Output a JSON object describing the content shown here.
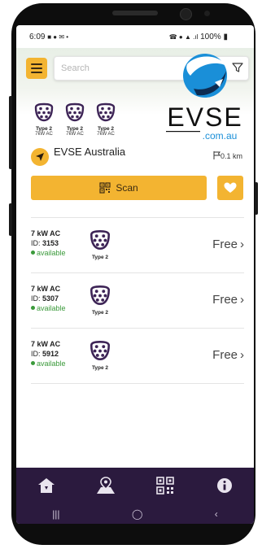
{
  "status_bar": {
    "time": "6:09",
    "battery": "100%"
  },
  "search": {
    "placeholder": "Search"
  },
  "logo": {
    "brand": "EVSE",
    "domain": ".com.au"
  },
  "connectors": [
    {
      "type": "Type 2",
      "power": "7kW AC"
    },
    {
      "type": "Type 2",
      "power": "7kW AC"
    },
    {
      "type": "Type 2",
      "power": "7kW AC"
    }
  ],
  "site": {
    "name": "EVSE Australia",
    "distance": "0.1 km"
  },
  "actions": {
    "scan_label": "Scan"
  },
  "chargers": [
    {
      "power": "7 kW AC",
      "id_label": "ID:",
      "id": "3153",
      "status": "available",
      "connector": "Type 2",
      "price": "Free"
    },
    {
      "power": "7 kW AC",
      "id_label": "ID:",
      "id": "5307",
      "status": "available",
      "connector": "Type 2",
      "price": "Free"
    },
    {
      "power": "7 kW AC",
      "id_label": "ID:",
      "id": "5912",
      "status": "available",
      "connector": "Type 2",
      "price": "Free"
    }
  ],
  "colors": {
    "accent": "#f3b431",
    "nav_bg": "#2b1a3e",
    "available": "#3b9a3b",
    "icon_purple": "#3d2456"
  },
  "icons": [
    "menu-icon",
    "filter-icon",
    "navigate-icon",
    "flag-icon",
    "qr-icon",
    "heart-icon",
    "home-icon",
    "map-pin-icon",
    "qr-code-icon",
    "info-icon"
  ]
}
